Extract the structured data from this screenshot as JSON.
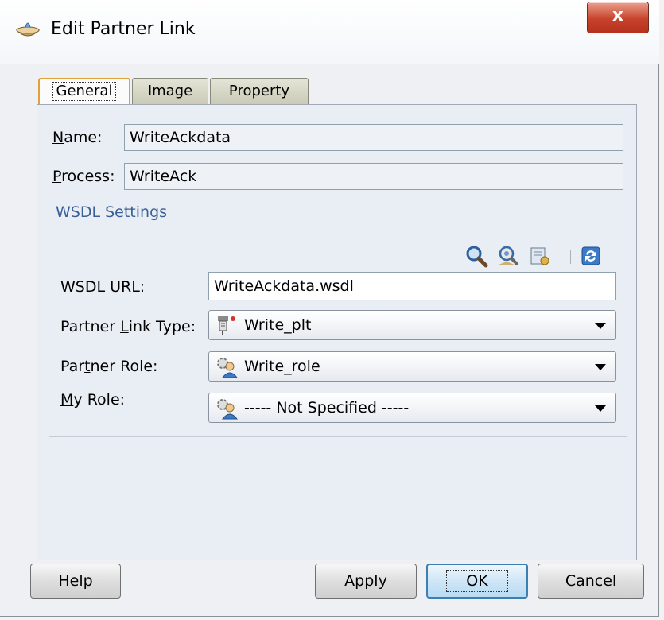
{
  "window": {
    "title": "Edit Partner Link",
    "close_label": "x"
  },
  "tabs": [
    {
      "label": "General",
      "active": true
    },
    {
      "label": "Image",
      "active": false
    },
    {
      "label": "Property",
      "active": false
    }
  ],
  "general": {
    "name_label_u": "N",
    "name_label_rest": "ame:",
    "name_value": "WriteAckdata",
    "process_label_u": "P",
    "process_label_rest": "rocess:",
    "process_value": "WriteAck"
  },
  "wsdl": {
    "group_title": "WSDL Settings",
    "toolbar_icons": [
      "search-icon",
      "browse-services-icon",
      "service-wizard-icon",
      "refresh-icon"
    ],
    "url_label_u": "W",
    "url_label_rest": "SDL URL:",
    "url_value": "WriteAckdata.wsdl",
    "plt_label_pre": "Partner ",
    "plt_label_u": "L",
    "plt_label_post": "ink Type:",
    "plt_value": "Write_plt",
    "partner_role_label_pre": "Par",
    "partner_role_label_u": "t",
    "partner_role_label_post": "ner Role:",
    "partner_role_value": "Write_role",
    "my_role_label_u": "M",
    "my_role_label_rest": "y Role:",
    "my_role_value": "----- Not Specified -----"
  },
  "buttons": {
    "help_u": "H",
    "help_rest": "elp",
    "apply_u": "A",
    "apply_rest": "pply",
    "ok": "OK",
    "cancel": "Cancel"
  },
  "colors": {
    "group_title": "#3a5f96",
    "active_tab_border": "#e0a33a",
    "close_button": "#c8432c",
    "default_button_border": "#3c7fb1"
  }
}
